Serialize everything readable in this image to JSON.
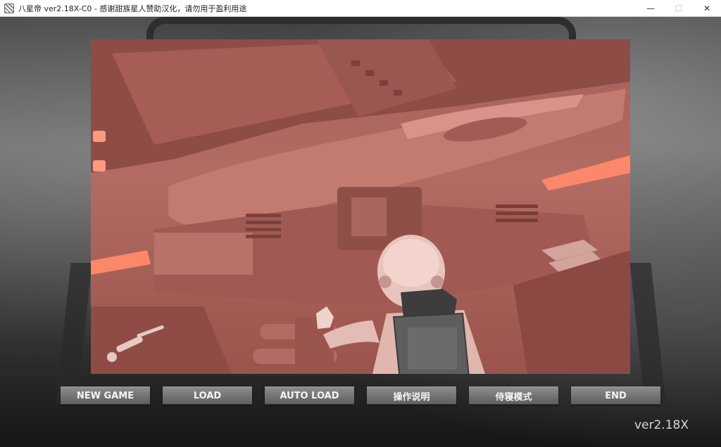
{
  "window": {
    "title": "八星帝 ver2.18X-C0 - 感谢甜族星人赞助汉化，请勿用于盈利用途",
    "app_icon": "app-icon",
    "controls": {
      "minimize": "—",
      "maximize": "☐",
      "close": "✕"
    }
  },
  "menu": {
    "buttons": [
      {
        "label": "NEW GAME"
      },
      {
        "label": "LOAD"
      },
      {
        "label": "AUTO LOAD"
      },
      {
        "label": "操作说明"
      },
      {
        "label": "侍寝模式"
      },
      {
        "label": "END"
      }
    ]
  },
  "version_label": "ver2.18X",
  "colors": {
    "scene_tint": "#b06a62",
    "button_top": "#8c8c8c",
    "button_bottom": "#5e5e5e",
    "button_text": "#f4f4f4",
    "thruster_glow": "#ff8a6a"
  }
}
